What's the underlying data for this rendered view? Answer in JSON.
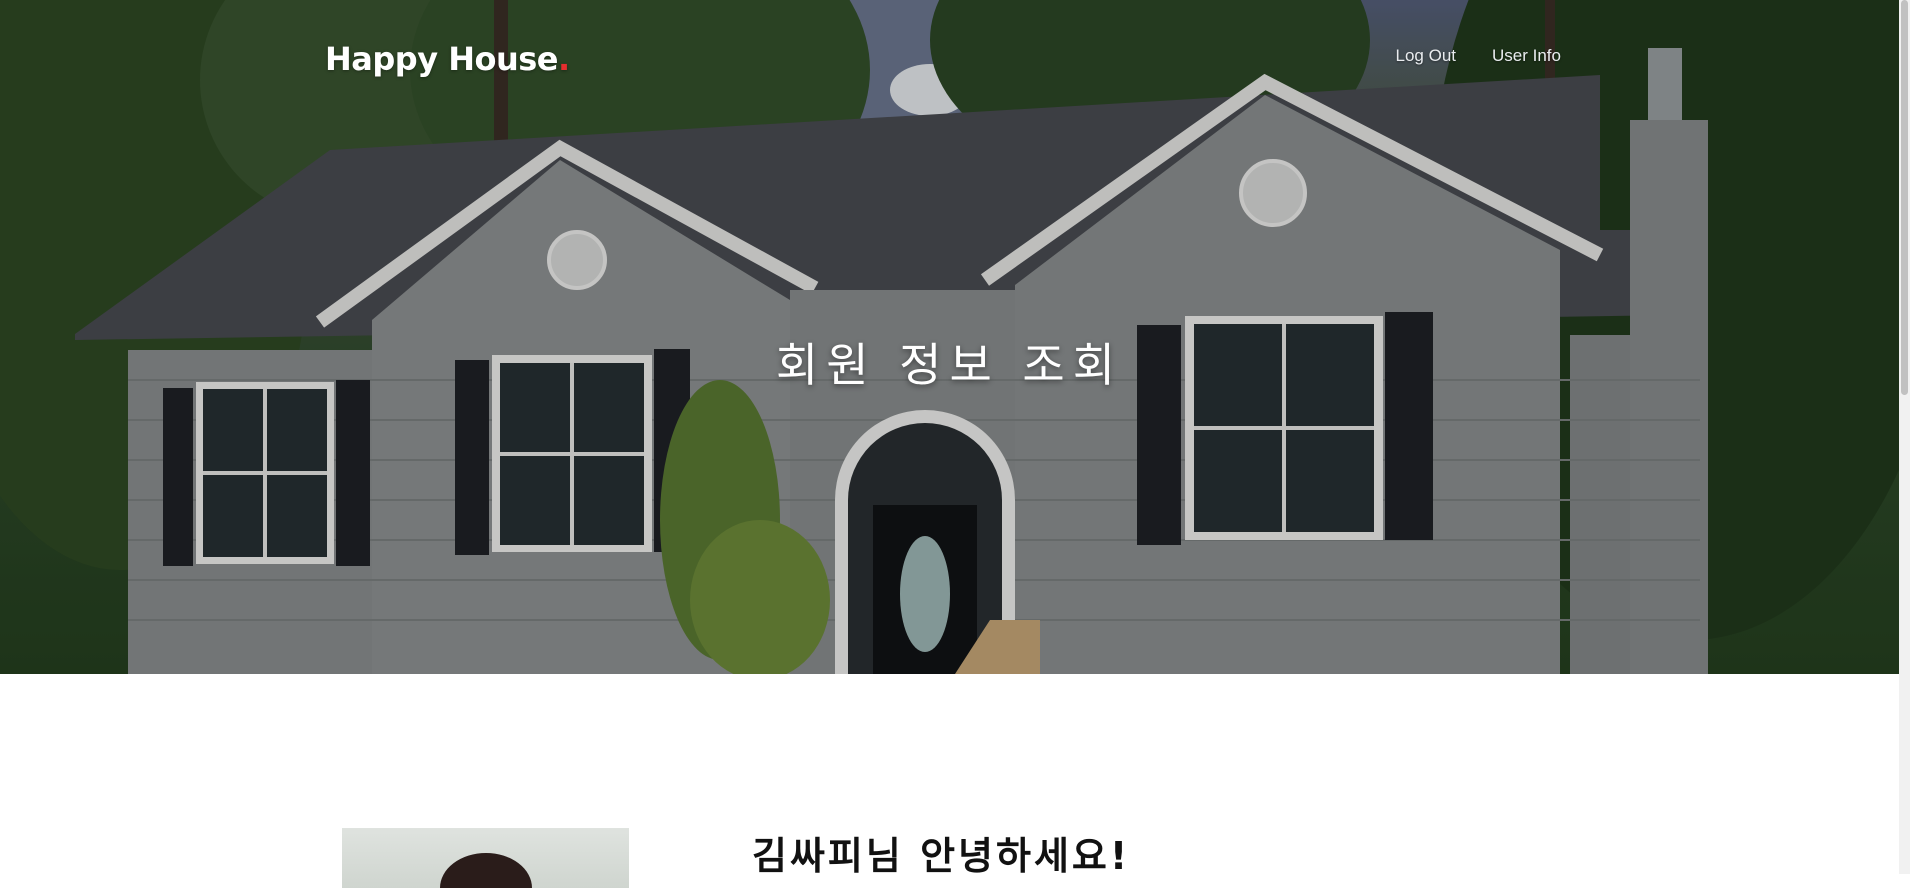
{
  "header": {
    "brand": "Happy House",
    "brand_dot": ".",
    "nav": [
      {
        "label": "Log Out"
      },
      {
        "label": "User Info"
      }
    ]
  },
  "hero": {
    "title": "회원 정보 조회"
  },
  "main": {
    "greeting": "김싸피님 안녕하세요!"
  },
  "colors": {
    "brand_dot": "#e52e2e",
    "hero_text": "#ffffff"
  }
}
